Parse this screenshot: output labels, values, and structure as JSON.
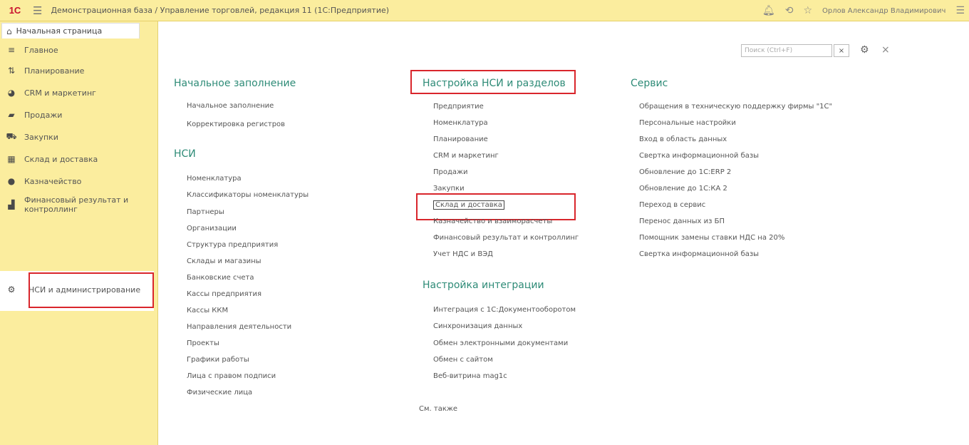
{
  "window": {
    "logo": "1С",
    "title": "Демонстрационная база / Управление торговлей, редакция 11  (1С:Предприятие)",
    "user": "Орлов Александр Владимирович"
  },
  "sidebar": {
    "home_tab": "Начальная страница",
    "items": [
      {
        "label": "Главное"
      },
      {
        "label": "Планирование"
      },
      {
        "label": "CRM и маркетинг"
      },
      {
        "label": "Продажи"
      },
      {
        "label": "Закупки"
      },
      {
        "label": "Склад и доставка"
      },
      {
        "label": "Казначейство"
      },
      {
        "label": "Финансовый результат и контроллинг"
      },
      {
        "label": "НСИ и администрирование"
      }
    ]
  },
  "main": {
    "search_placeholder": "Поиск (Ctrl+F)",
    "col1": {
      "sections": [
        {
          "title": "Начальное заполнение",
          "links": [
            "Начальное заполнение",
            "Корректировка регистров"
          ]
        },
        {
          "title": "НСИ",
          "links": [
            "Номенклатура",
            "Классификаторы номенклатуры",
            "Партнеры",
            "Организации",
            "Структура предприятия",
            "Склады и магазины",
            "Банковские счета",
            "Кассы предприятия",
            "Кассы ККМ",
            "Направления деятельности",
            "Проекты",
            "Графики работы",
            "Лица с правом подписи",
            "Физические лица"
          ]
        }
      ]
    },
    "col2": {
      "sections": [
        {
          "title": "Настройка НСИ и разделов",
          "links": [
            "Предприятие",
            "Номенклатура",
            "Планирование",
            "CRM и маркетинг",
            "Продажи",
            "Закупки",
            "Склад и доставка",
            "Казначейство и взаиморасчеты",
            "Финансовый результат и контроллинг",
            "Учет НДС и ВЭД"
          ]
        },
        {
          "title": "Настройка интеграции",
          "links": [
            "Интеграция с 1С:Документооборотом",
            "Синхронизация данных",
            "Обмен электронными документами",
            "Обмен с сайтом",
            "Веб-витрина mag1c"
          ]
        }
      ],
      "see_also": "См. также"
    },
    "col3": {
      "sections": [
        {
          "title": "Сервис",
          "links": [
            "Обращения в техническую поддержку фирмы \"1С\"",
            "Персональные настройки",
            "Вход в область данных",
            "Свертка информационной базы",
            "Обновление до 1С:ERP 2",
            "Обновление до 1С:КА 2",
            "Переход в сервис",
            "Перенос данных из БП",
            "Помощник замены ставки НДС на 20%",
            "Свертка информационной базы"
          ]
        }
      ]
    }
  },
  "colors": {
    "accent": "#2e8b77",
    "highlight": "#d9262c",
    "panel": "#fbed9e"
  }
}
